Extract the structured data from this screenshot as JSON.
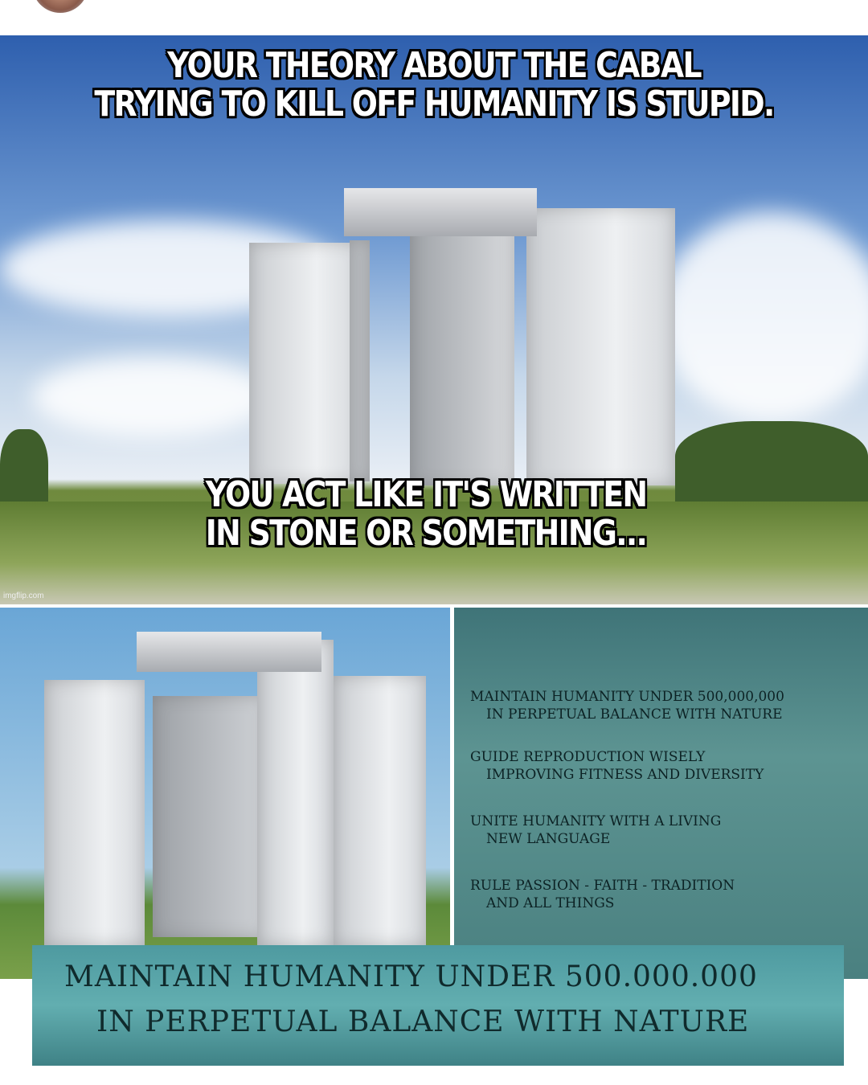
{
  "meme": {
    "top_caption": [
      "YOUR THEORY ABOUT THE CABAL",
      "TRYING TO KILL OFF HUMANITY IS STUPID."
    ],
    "bottom_caption": [
      "YOU ACT LIKE IT'S WRITTEN",
      "IN STONE OR SOMETHING..."
    ],
    "watermark": "imgflip.com",
    "close_up_inscription": [
      "MAINTAIN HUMANITY UNDER 500,000,000",
      "IN PERPETUAL BALANCE WITH NATURE",
      "GUIDE REPRODUCTION WISELY",
      "IMPROVING FITNESS AND DIVERSITY",
      "UNITE HUMANITY WITH A LIVING",
      "NEW LANGUAGE",
      "RULE PASSION - FAITH - TRADITION",
      "AND ALL THINGS"
    ],
    "bottom_inscription": [
      "MAINTAIN HUMANITY UNDER 500.000.000",
      "IN PERPETUAL BALANCE WITH NATURE"
    ]
  }
}
